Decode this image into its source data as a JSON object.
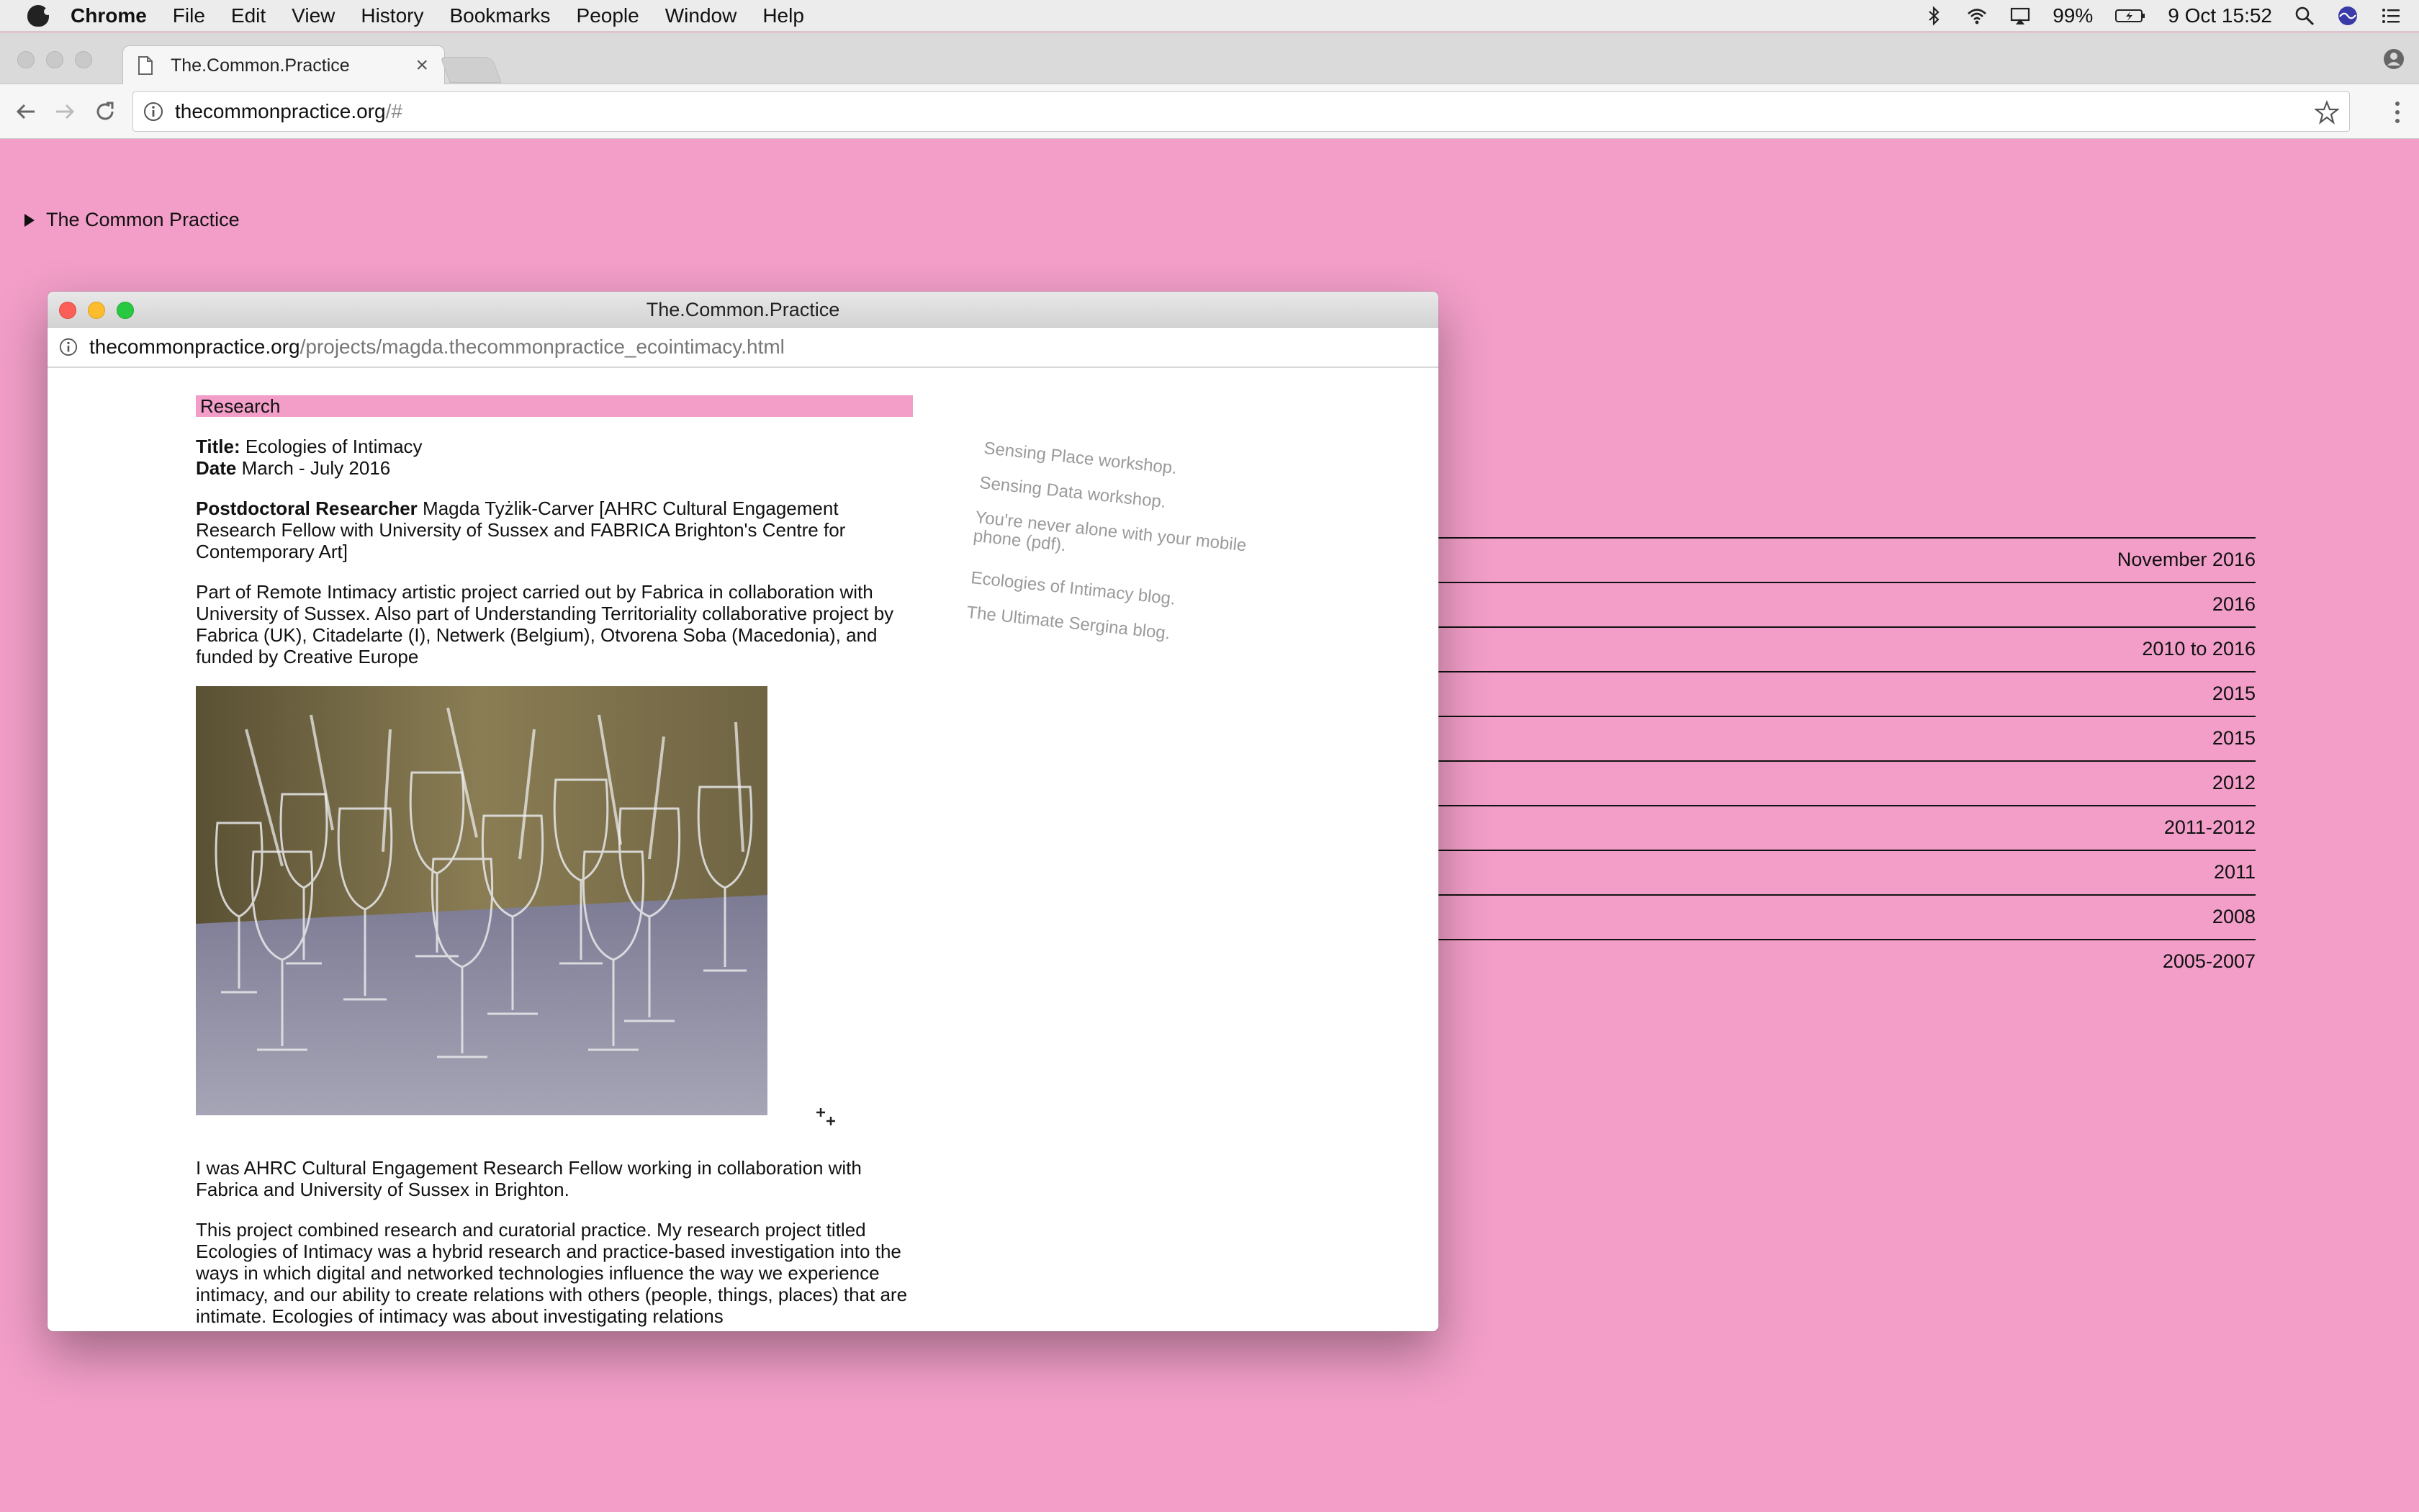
{
  "menubar": {
    "app": "Chrome",
    "items": [
      "File",
      "Edit",
      "View",
      "History",
      "Bookmarks",
      "People",
      "Window",
      "Help"
    ],
    "battery": "99%",
    "datetime": "9 Oct  15:52"
  },
  "browser": {
    "tab_title": "The.Common.Practice",
    "url_host": "thecommonpractice.org",
    "url_path": "/#"
  },
  "page": {
    "site_title": "The Common Practice",
    "years": [
      "November 2016",
      "2016",
      "2010 to 2016",
      "2015",
      "2015",
      "2012",
      "2011-2012",
      "2011",
      "2008",
      "2005-2007"
    ]
  },
  "popup": {
    "window_title": "The.Common.Practice",
    "url_host": "thecommonpractice.org",
    "url_path": "/projects/magda.thecommonpractice_ecointimacy.html",
    "section": "Research",
    "title_label": "Title:",
    "title_value": "Ecologies of Intimacy",
    "date_label": "Date",
    "date_value": "March - July 2016",
    "role_label": "Postdoctoral Researcher",
    "role_value": "Magda Tyżlik-Carver [AHRC Cultural Engagement Research Fellow with University of Sussex and FABRICA Brighton's Centre for Contemporary Art]",
    "description": "Part of Remote Intimacy artistic project carried out by Fabrica in collaboration with University of Sussex. Also part of Understanding Territoriality collaborative project by Fabrica (UK), Citadelarte (I), Netwerk (Belgium), Otvorena Soba (Macedonia), and funded by Creative Europe",
    "para1": "I was AHRC Cultural Engagement Research Fellow working in collaboration with Fabrica and University of Sussex in Brighton.",
    "para2": "This project combined research and curatorial practice. My research project titled Ecologies of Intimacy was a hybrid research and practice-based investigation into the ways in which digital and networked technologies influence the way we experience intimacy, and our ability to create relations with others (people, things, places) that are intimate. Ecologies of intimacy was about investigating relations",
    "side_links": [
      "Sensing Place workshop.",
      "Sensing Data workshop.",
      "You're never alone with your mobile phone (pdf).",
      "Ecologies of Intimacy blog.",
      "The Ultimate Sergina blog."
    ]
  }
}
